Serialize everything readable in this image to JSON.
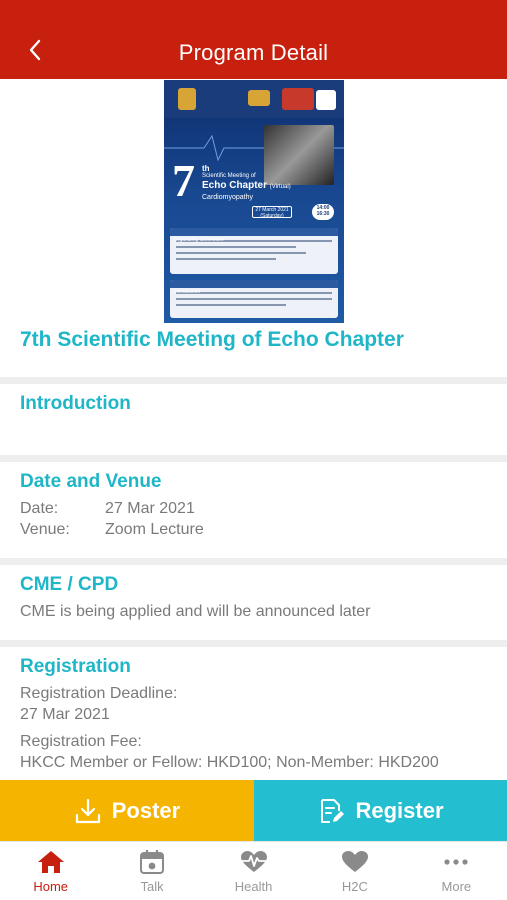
{
  "header": {
    "title": "Program Detail"
  },
  "event": {
    "title": "7th Scientific Meeting of Echo Chapter"
  },
  "poster_image": {
    "seven": "7",
    "th": "th",
    "line1": "Scientific Meeting of",
    "line2": "Echo Chapter",
    "virtual": "(Virtual)",
    "line3": "Cardiomyopathy",
    "date": "27 March 2021",
    "day": "(Saturday)",
    "time1": "14:00",
    "time2": "16:30",
    "committee_heading": "Organizing Committee",
    "intro_heading": "Introduction"
  },
  "sections": {
    "introduction": {
      "title": "Introduction"
    },
    "date_venue": {
      "title": "Date and Venue",
      "date_label": "Date:",
      "date_value": "27 Mar 2021",
      "venue_label": "Venue:",
      "venue_value": "Zoom Lecture"
    },
    "cme": {
      "title": "CME / CPD",
      "text": "CME is being applied and will be announced later"
    },
    "registration": {
      "title": "Registration",
      "deadline_label": "Registration Deadline:",
      "deadline_value": "27 Mar 2021",
      "fee_label": "Registration Fee:",
      "fee_value": "HKCC Member or Fellow: HKD100; Non-Member: HKD200"
    }
  },
  "actions": {
    "poster_label": "Poster",
    "register_label": "Register"
  },
  "tabbar": {
    "items": [
      {
        "label": "Home",
        "icon": "home-icon",
        "active": true
      },
      {
        "label": "Talk",
        "icon": "calendar-icon"
      },
      {
        "label": "Health",
        "icon": "heart-pulse-icon"
      },
      {
        "label": "H2C",
        "icon": "heart-icon"
      },
      {
        "label": "More",
        "icon": "more-icon"
      }
    ]
  },
  "colors": {
    "header": "#c8200f",
    "accent_teal": "#1fb6c8",
    "poster_button": "#f5b400",
    "register_button": "#23bfd0",
    "active_tab": "#c8200f"
  }
}
